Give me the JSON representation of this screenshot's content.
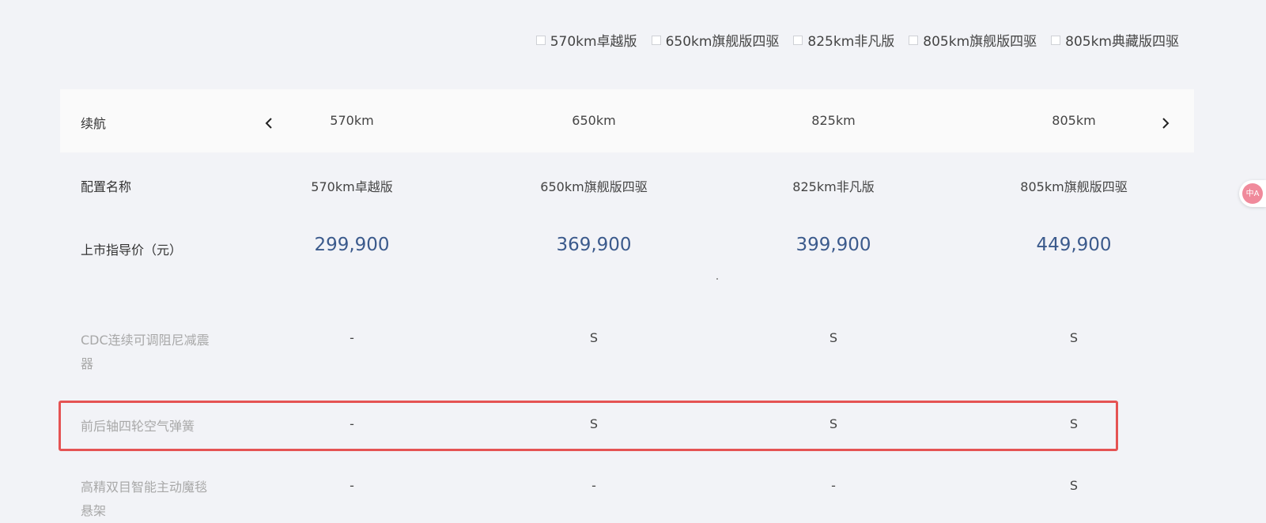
{
  "filters": [
    {
      "label": "570km卓越版"
    },
    {
      "label": "650km旗舰版四驱"
    },
    {
      "label": "825km非凡版"
    },
    {
      "label": "805km旗舰版四驱"
    },
    {
      "label": "805km典藏版四驱"
    }
  ],
  "range": {
    "label": "续航",
    "values": [
      "570km",
      "650km",
      "825km",
      "805km"
    ]
  },
  "config_name": {
    "label": "配置名称",
    "values": [
      "570km卓越版",
      "650km旗舰版四驱",
      "825km非凡版",
      "805km旗舰版四驱"
    ]
  },
  "price": {
    "label": "上市指导价（元）",
    "values": [
      "299,900",
      "369,900",
      "399,900",
      "449,900"
    ]
  },
  "features": [
    {
      "label_line1": "CDC连续可调阻尼减震",
      "label_line2": "器",
      "values": [
        "-",
        "S",
        "S",
        "S"
      ]
    },
    {
      "label_line1": "前后轴四轮空气弹簧",
      "label_line2": "",
      "values": [
        "-",
        "S",
        "S",
        "S"
      ]
    },
    {
      "label_line1": "高精双目智能主动魔毯",
      "label_line2": "悬架",
      "values": [
        "-",
        "-",
        "-",
        "S"
      ]
    }
  ],
  "translate_widget": {
    "text": "中A"
  },
  "colors": {
    "price": "#3b5a8c",
    "highlight": "#e55353",
    "background": "#f2f3f7"
  }
}
